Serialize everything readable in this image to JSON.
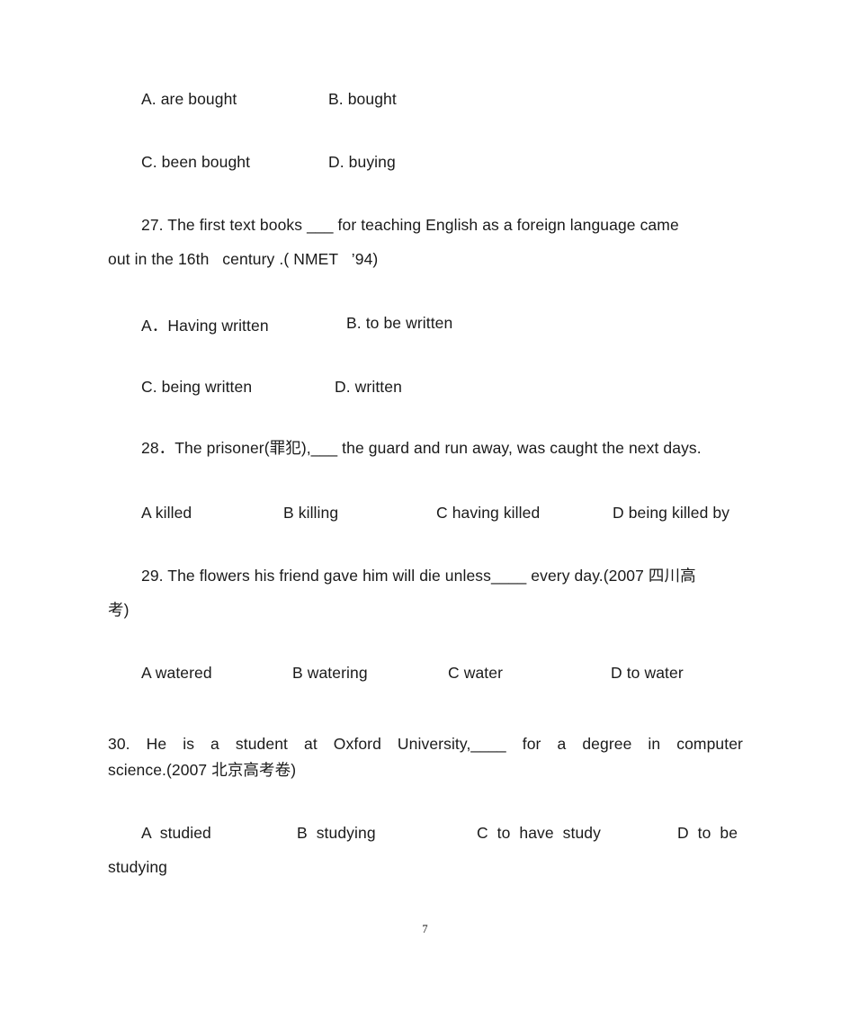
{
  "document": {
    "page_number": "7",
    "language": "English grammar exercise with Chinese annotations"
  },
  "questions": [
    {
      "id": "q26-options",
      "number": "",
      "stem": "",
      "option_rows": [
        {
          "cells": [
            "A. are bought",
            "B. bought"
          ]
        },
        {
          "cells": [
            "C. been bought",
            "D. buying"
          ]
        }
      ]
    },
    {
      "id": "q27",
      "number": "27.",
      "stem_line1": "27. The first text books ___ for teaching English as a foreign language came",
      "stem_line2": "out in the 16th   century .( NMET   ’94)",
      "option_rows": [
        {
          "cells": [
            "A．Having written",
            "B. to be written"
          ]
        },
        {
          "cells": [
            "C. being written",
            "D. written"
          ]
        }
      ]
    },
    {
      "id": "q28",
      "number": "28．",
      "stem_line1": "28．The prisoner(罪犯),___ the guard and run away, was caught the next days.",
      "option_rows": [
        {
          "cells": [
            "A killed",
            "B killing",
            "C having killed",
            "D being killed by"
          ]
        }
      ]
    },
    {
      "id": "q29",
      "number": "29.",
      "stem_line1": "29. The flowers his friend gave him will die unless____ every day.(2007 四川高",
      "stem_line2": "考)",
      "option_rows": [
        {
          "cells": [
            "A watered",
            "B watering",
            "C water",
            "D to water"
          ]
        }
      ]
    },
    {
      "id": "q30",
      "number": "30.",
      "stem_line1": "30. He is a student at Oxford University,____ for a degree in computer",
      "stem_line2": "science.(2007 北京高考卷)",
      "option_rows": [
        {
          "cells": [
            "A studied",
            "B studying",
            "C to have study",
            "D to be"
          ]
        },
        {
          "cells": [
            "studying"
          ]
        }
      ]
    }
  ],
  "lines": {
    "l1_a": "A. are bought",
    "l1_b": "B. bought",
    "l2_c": "C. been bought",
    "l2_d": "D. buying",
    "q27_l1": "27. The first text books ___ for teaching English as a foreign language came",
    "q27_l2": "out in the 16th   century .( NMET   ’94)",
    "q27_a": "A．Having written",
    "q27_b": "B. to be written",
    "q27_c": "C. being written",
    "q27_d": "D. written",
    "q28_l1": "28．The prisoner(罪犯),___ the guard and run away, was caught the next days.",
    "q28_a": "A killed",
    "q28_b": "B killing",
    "q28_c": "C having killed",
    "q28_d": "D being killed by",
    "q29_l1": "29. The flowers his friend gave him will die unless____ every day.(2007 四川高",
    "q29_l2": "考)",
    "q29_a": "A watered",
    "q29_b": "B watering",
    "q29_c": "C water",
    "q29_d": "D to water",
    "q30_l1": "30. He is a student at Oxford University,____ for a degree in computer",
    "q30_l2": "science.(2007 北京高考卷)",
    "q30_a": "A  studied",
    "q30_b": "B  studying",
    "q30_c": "C  to  have  study",
    "q30_d": "D  to  be",
    "q30_wrap": "studying",
    "page_number": "7"
  },
  "colors": {
    "page_background": "#ffffff",
    "text": "#1a1a1a"
  }
}
